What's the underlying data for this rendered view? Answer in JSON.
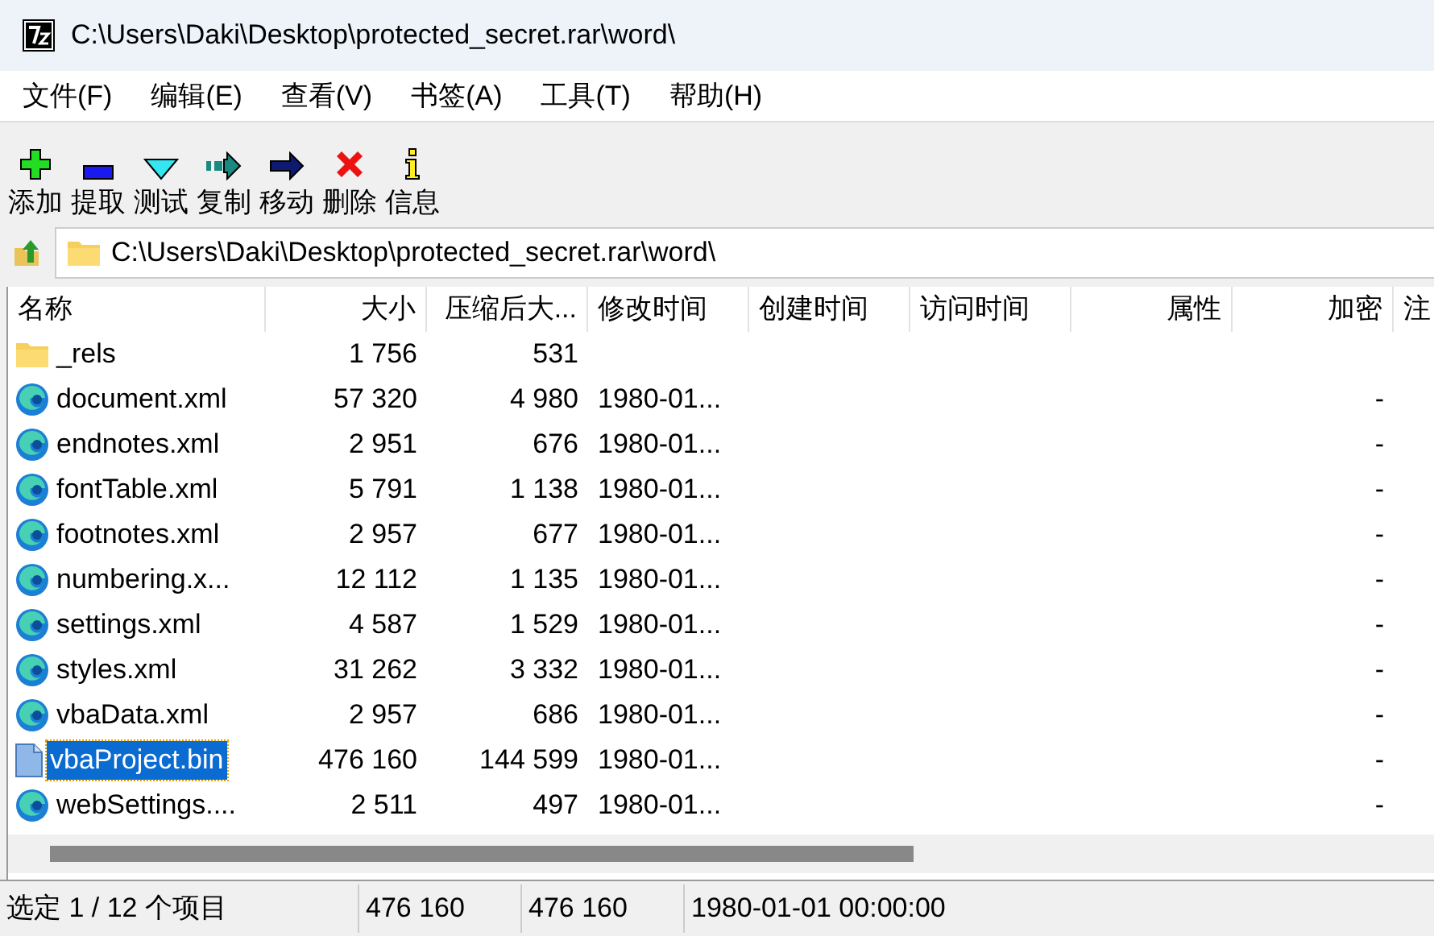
{
  "window": {
    "title": "C:\\Users\\Daki\\Desktop\\protected_secret.rar\\word\\"
  },
  "menu": [
    "文件(F)",
    "编辑(E)",
    "查看(V)",
    "书签(A)",
    "工具(T)",
    "帮助(H)"
  ],
  "toolbar": [
    {
      "kind": "add",
      "label": "添加"
    },
    {
      "kind": "extract",
      "label": "提取"
    },
    {
      "kind": "test",
      "label": "测试"
    },
    {
      "kind": "copy",
      "label": "复制"
    },
    {
      "kind": "move",
      "label": "移动"
    },
    {
      "kind": "delete",
      "label": "删除"
    },
    {
      "kind": "info",
      "label": "信息"
    }
  ],
  "address": {
    "value": "C:\\Users\\Daki\\Desktop\\protected_secret.rar\\word\\"
  },
  "table": {
    "columns": [
      "名称",
      "大小",
      "压缩后大...",
      "修改时间",
      "创建时间",
      "访问时间",
      "属性",
      "加密",
      "注"
    ],
    "rows": [
      {
        "kind": "folder",
        "name": "_rels",
        "size": "1 756",
        "packed": "531",
        "selected": false
      },
      {
        "kind": "edge",
        "name": "document.xml",
        "size": "57 320",
        "packed": "4 980",
        "modified": "1980-01...",
        "encrypted": "-",
        "selected": false
      },
      {
        "kind": "edge",
        "name": "endnotes.xml",
        "size": "2 951",
        "packed": "676",
        "modified": "1980-01...",
        "encrypted": "-",
        "selected": false
      },
      {
        "kind": "edge",
        "name": "fontTable.xml",
        "size": "5 791",
        "packed": "1 138",
        "modified": "1980-01...",
        "encrypted": "-",
        "selected": false
      },
      {
        "kind": "edge",
        "name": "footnotes.xml",
        "size": "2 957",
        "packed": "677",
        "modified": "1980-01...",
        "encrypted": "-",
        "selected": false
      },
      {
        "kind": "edge",
        "name": "numbering.x...",
        "size": "12 112",
        "packed": "1 135",
        "modified": "1980-01...",
        "encrypted": "-",
        "selected": false
      },
      {
        "kind": "edge",
        "name": "settings.xml",
        "size": "4 587",
        "packed": "1 529",
        "modified": "1980-01...",
        "encrypted": "-",
        "selected": false
      },
      {
        "kind": "edge",
        "name": "styles.xml",
        "size": "31 262",
        "packed": "3 332",
        "modified": "1980-01...",
        "encrypted": "-",
        "selected": false
      },
      {
        "kind": "edge",
        "name": "vbaData.xml",
        "size": "2 957",
        "packed": "686",
        "modified": "1980-01...",
        "encrypted": "-",
        "selected": false
      },
      {
        "kind": "file",
        "name": "vbaProject.bin",
        "size": "476 160",
        "packed": "144 599",
        "modified": "1980-01...",
        "encrypted": "-",
        "selected": true
      },
      {
        "kind": "edge",
        "name": "webSettings....",
        "size": "2 511",
        "packed": "497",
        "modified": "1980-01...",
        "encrypted": "-",
        "selected": false
      }
    ]
  },
  "status_bar": [
    "选定 1 / 12 个项目",
    "476 160",
    "476 160",
    "1980-01-01 00:00:00"
  ]
}
